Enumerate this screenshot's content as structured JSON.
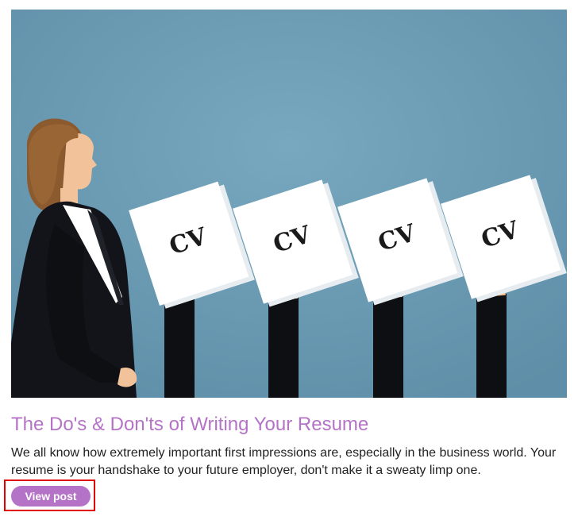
{
  "post": {
    "image": {
      "background_color": "#6b9bb4",
      "card_text": "CV"
    },
    "title": "The Do's & Don'ts of Writing Your Resume",
    "excerpt": "We all know how extremely important first impressions are, especially in the business world. Your resume is your handshake to your future employer, don't make it a sweaty limp one.",
    "button_label": "View post",
    "accent_color": "#b573c7"
  }
}
